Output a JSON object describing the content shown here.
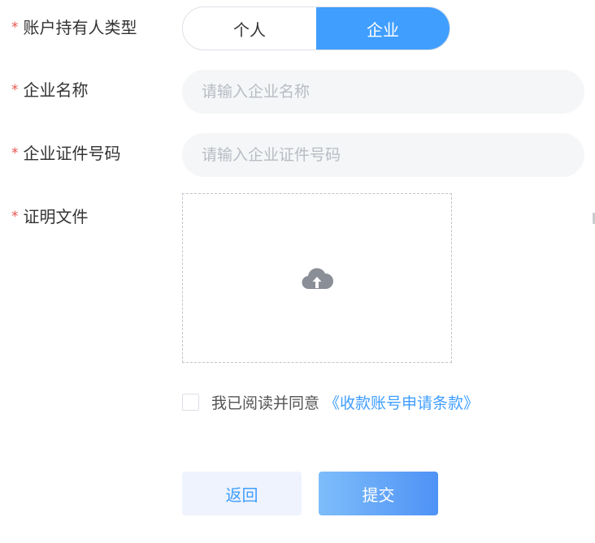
{
  "form": {
    "required_mark": "*",
    "account_type": {
      "label": "账户持有人类型",
      "options": [
        "个人",
        "企业"
      ],
      "selected": "企业"
    },
    "company_name": {
      "label": "企业名称",
      "value": "",
      "placeholder": "请输入企业名称"
    },
    "company_cert_no": {
      "label": "企业证件号码",
      "value": "",
      "placeholder": "请输入企业证件号码"
    },
    "proof_file": {
      "label": "证明文件",
      "icon": "cloud-upload-icon"
    },
    "agreement": {
      "checked": false,
      "text": "我已阅读并同意",
      "link_text": "《收款账号申请条款》"
    }
  },
  "actions": {
    "back_label": "返回",
    "submit_label": "提交"
  },
  "colors": {
    "primary": "#409eff",
    "required": "#e8554e",
    "input_bg": "#f4f6f7"
  }
}
